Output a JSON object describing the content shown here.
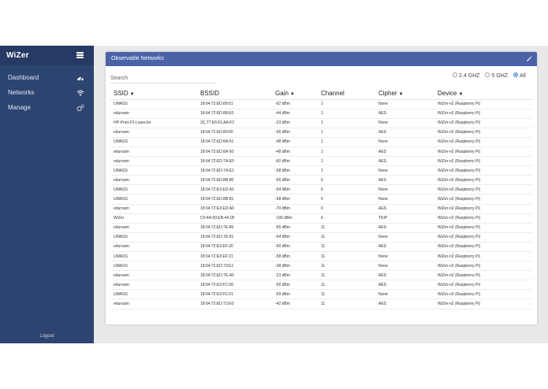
{
  "sidebar": {
    "brand": "WiZer",
    "items": [
      {
        "label": "Dashboard",
        "icon": "gauge-icon"
      },
      {
        "label": "Networks",
        "icon": "wifi-icon"
      },
      {
        "label": "Manage",
        "icon": "cogs-icon"
      }
    ],
    "logout": "Logout"
  },
  "card": {
    "title": "Observable Networks",
    "search_placeholder": "Search",
    "bands": [
      {
        "label": "2.4 GHZ",
        "checked": false
      },
      {
        "label": "5 GHZ",
        "checked": false
      },
      {
        "label": "All",
        "checked": true
      }
    ]
  },
  "table": {
    "columns": [
      {
        "label": "SSID",
        "sortable": true
      },
      {
        "label": "BSSID",
        "sortable": false
      },
      {
        "label": "Gain",
        "sortable": true
      },
      {
        "label": "Channel",
        "sortable": false
      },
      {
        "label": "Cipher",
        "sortable": true
      },
      {
        "label": "Device",
        "sortable": true
      }
    ],
    "sort_arrow": "▼",
    "rows": [
      [
        "UMASS",
        "18:64:72:ED:89:61",
        "-62 dBm",
        "1",
        "None",
        "WiZer-n2 (Raspberry Pi)"
      ],
      [
        "eduroam",
        "18:64:72:ED:88:E0",
        "-44 dBm",
        "1",
        "AES",
        "WiZer-n2 (Raspberry Pi)"
      ],
      [
        "HP-Print-F2-LaserJet",
        "3C:77:E6:61:AA:F2",
        "-23 dBm",
        "1",
        "None",
        "WiZer-n2 (Raspberry Pi)"
      ],
      [
        "eduroam",
        "18:64:72:ED:89:60",
        "-56 dBm",
        "1",
        "AES",
        "WiZer-n2 (Raspberry Pi)"
      ],
      [
        "UMASS",
        "18:64:72:ED:8A:61",
        "-48 dBm",
        "1",
        "None",
        "WiZer-n2 (Raspberry Pi)"
      ],
      [
        "eduroam",
        "18:64:72:ED:8A:60",
        "-48 dBm",
        "1",
        "AES",
        "WiZer-n2 (Raspberry Pi)"
      ],
      [
        "eduroam",
        "18:64:72:ED:7A:E0",
        "-60 dBm",
        "1",
        "AES",
        "WiZer-n2 (Raspberry Pi)"
      ],
      [
        "UMASS",
        "18:64:72:ED:7A:E1",
        "-58 dBm",
        "1",
        "None",
        "WiZer-n2 (Raspberry Pi)"
      ],
      [
        "eduroam",
        "18:64:72:ED:8B:80",
        "-56 dBm",
        "6",
        "AES",
        "WiZer-n2 (Raspberry Pi)"
      ],
      [
        "UMASS",
        "18:64:72:E3:ED:A1",
        "-64 dBm",
        "6",
        "None",
        "WiZer-n2 (Raspberry Pi)"
      ],
      [
        "UMASS",
        "18:64:72:ED:8B:81",
        "-58 dBm",
        "6",
        "None",
        "WiZer-n2 (Raspberry Pi)"
      ],
      [
        "eduroam",
        "18:64:72:E3:ED:A0",
        "-70 dBm",
        "6",
        "AES",
        "WiZer-n2 (Raspberry Pi)"
      ],
      [
        "WiZer",
        "C0:4A:00:EB:44:1B",
        "-100 dBm",
        "6",
        "TKIP",
        "WiZer-n2 (Raspberry Pi)"
      ],
      [
        "eduroam",
        "18:64:72:ED:7E:80",
        "-65 dBm",
        "11",
        "AES",
        "WiZer-n2 (Raspberry Pi)"
      ],
      [
        "UMASS",
        "18:64:72:ED:7E:81",
        "-64 dBm",
        "11",
        "None",
        "WiZer-n2 (Raspberry Pi)"
      ],
      [
        "eduroam",
        "18:64:72:E3:EF:20",
        "-60 dBm",
        "11",
        "AES",
        "WiZer-n2 (Raspberry Pi)"
      ],
      [
        "UMASS",
        "18:64:72:E3:EF:21",
        "-58 dBm",
        "11",
        "None",
        "WiZer-n2 (Raspberry Pi)"
      ],
      [
        "UMASS",
        "18:64:72:ED:73:E1",
        "-38 dBm",
        "11",
        "None",
        "WiZer-n2 (Raspberry Pi)"
      ],
      [
        "eduroam",
        "18:64:72:ED:7E:A0",
        "-23 dBm",
        "11",
        "AES",
        "WiZer-n2 (Raspberry Pi)"
      ],
      [
        "eduroam",
        "18:64:72:E3:FC:00",
        "-56 dBm",
        "11",
        "AES",
        "WiZer-n2 (Raspberry Pi)"
      ],
      [
        "UMASS",
        "18:64:72:E3:FC:01",
        "-59 dBm",
        "11",
        "None",
        "WiZer-n2 (Raspberry Pi)"
      ],
      [
        "eduroam",
        "18:64:72:ED:73:E0",
        "-42 dBm",
        "11",
        "AES",
        "WiZer-n2 (Raspberry Pi)"
      ]
    ]
  },
  "colors": {
    "sidebar": "#2e4470",
    "card_header": "#4a62a8",
    "radio_checked": "#4a8fd8"
  }
}
